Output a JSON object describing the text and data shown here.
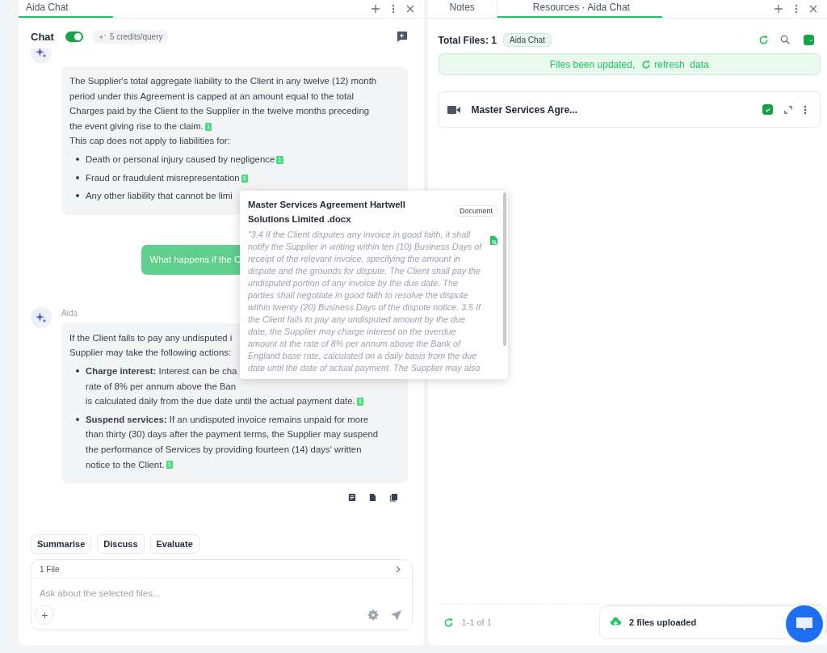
{
  "left_panel": {
    "tabs": [
      {
        "label": "Aida Chat",
        "selected": true
      }
    ],
    "chat_header": {
      "title": "Chat",
      "toggle_on": true,
      "credits": "5 credits/query"
    },
    "messages": [
      {
        "kind": "assistant",
        "blocks": [
          {
            "kind": "paragraph",
            "lines": [
              "The Supplier's total aggregate liability to the Client in any twelve (12) month",
              "period under this Agreement is capped at an amount equal to the total",
              "Charges paid by the Client to the Supplier in the twelve months preceding",
              "the event giving rise to the claim."
            ],
            "cite": "1"
          },
          {
            "kind": "paragraph",
            "lines": [
              "This cap does not apply to liabilities for:"
            ]
          },
          {
            "kind": "bullet",
            "lines": [
              "Death or personal injury caused by negligence"
            ],
            "cite": "1"
          },
          {
            "kind": "bullet",
            "lines": [
              "Fraud or fraudulent misrepresentation"
            ],
            "cite": "1"
          },
          {
            "kind": "bullet",
            "lines": [
              "Any other liability that cannot be limi"
            ]
          }
        ]
      },
      {
        "kind": "user",
        "text": "What happens if the C"
      },
      {
        "kind": "assistant",
        "sender": "Aida",
        "blocks": [
          {
            "kind": "paragraph",
            "lines": [
              "If the Client fails to pay any undisputed i",
              "Supplier may take the following actions:"
            ]
          },
          {
            "kind": "bullet",
            "lines": [
              "**Charge interest:** Interest can be cha",
              "rate of 8% per annum above the Ban",
              "is calculated daily from the due date until the actual payment date."
            ],
            "cite": "1"
          },
          {
            "kind": "bullet",
            "lines": [
              "**Suspend services:** If an undisputed invoice remains unpaid for more",
              "than thirty (30) days after the payment terms, the Supplier may suspend",
              "the performance of Services by providing fourteen (14) days' written",
              "notice to the Client."
            ],
            "cite": "1"
          }
        ]
      }
    ],
    "quick_actions": [
      "Summarise",
      "Discuss",
      "Evaluate"
    ],
    "composer": {
      "files": "1 File",
      "placeholder": "Ask about the selected files..."
    }
  },
  "popover": {
    "title": "Master Services Agreement Hartwell Solutions Limited .docx",
    "badge": "Document",
    "quote": "\"3.4 If the Client disputes any invoice in good faith, it shall notify the Supplier in writing within ten (10) Business Days of receipt of the relevant invoice, specifying the amount in dispute and the grounds for dispute. The Client shall pay the undisputed portion of any invoice by the due date. The parties shall negotiate in good faith to resolve the dispute within twenty (20) Business Days of the dispute notice. 3.5 If the Client fails to pay any undisputed amount by the due date, the Supplier may charge interest on the overdue amount at the rate of 8% per annum above the Bank of England base rate, calculated on a daily basis from the due date until the date of actual payment. The Supplier may also"
  },
  "right_panel": {
    "tabs": [
      {
        "label": "Notes",
        "selected": false
      },
      {
        "label": "Resources · Aida Chat",
        "selected": true
      }
    ],
    "total": "Total Files: 1",
    "badge": "Aida Chat",
    "select_all_checked": true,
    "banner": {
      "text": "Files been updated,",
      "link": "refresh  data"
    },
    "files": [
      {
        "name": "Master Services Agre...",
        "checked": true
      }
    ],
    "pagination": "1-1 of 1",
    "upload_toast": "2 files uploaded"
  }
}
